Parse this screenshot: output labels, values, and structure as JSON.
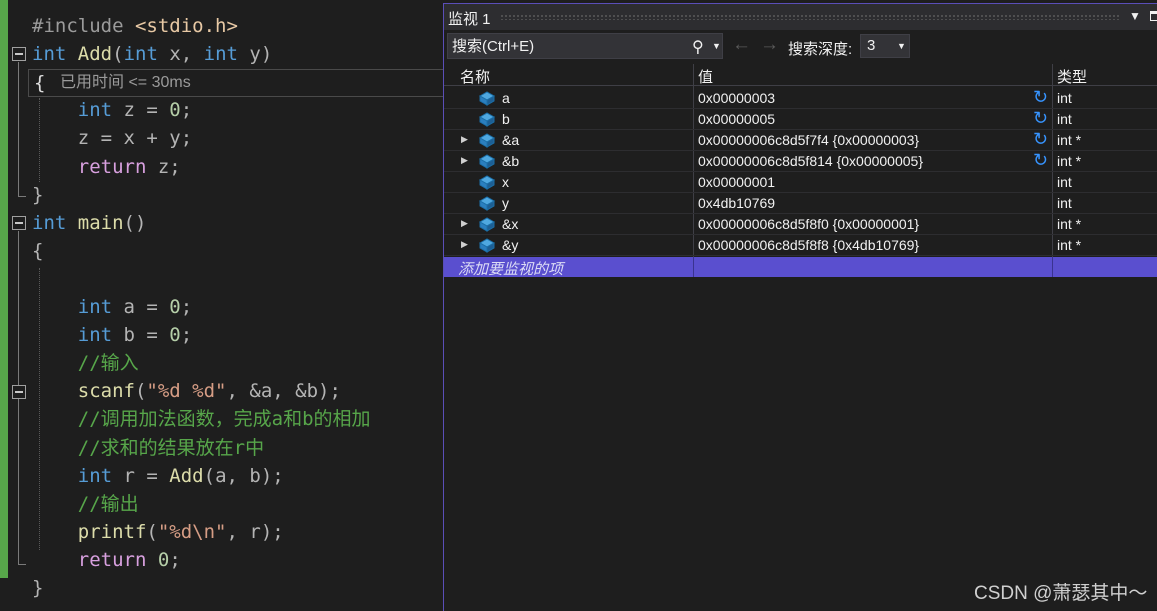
{
  "editor": {
    "perf_tip": "已用时间 <= 30ms",
    "lines": [
      [
        {
          "t": "#include ",
          "c": "pp"
        },
        {
          "t": "<stdio.h>",
          "c": "inc"
        }
      ],
      [
        {
          "t": "int",
          "c": "kw"
        },
        {
          "t": " ",
          "c": "pl"
        },
        {
          "t": "Add",
          "c": "fn"
        },
        {
          "t": "(",
          "c": "pl"
        },
        {
          "t": "int",
          "c": "kw"
        },
        {
          "t": " x, ",
          "c": "pl"
        },
        {
          "t": "int",
          "c": "kw"
        },
        {
          "t": " y)",
          "c": "pl"
        }
      ],
      [],
      [
        {
          "t": "    ",
          "c": "pl"
        },
        {
          "t": "int",
          "c": "kw"
        },
        {
          "t": " z = ",
          "c": "pl"
        },
        {
          "t": "0",
          "c": "num"
        },
        {
          "t": ";",
          "c": "pl"
        }
      ],
      [
        {
          "t": "    z = x + y;",
          "c": "pl"
        }
      ],
      [
        {
          "t": "    ",
          "c": "pl"
        },
        {
          "t": "return",
          "c": "ctl"
        },
        {
          "t": " z;",
          "c": "pl"
        }
      ],
      [
        {
          "t": "}",
          "c": "pl"
        }
      ],
      [
        {
          "t": "int",
          "c": "kw"
        },
        {
          "t": " ",
          "c": "pl"
        },
        {
          "t": "main",
          "c": "fn"
        },
        {
          "t": "()",
          "c": "pl"
        }
      ],
      [
        {
          "t": "{",
          "c": "pl"
        }
      ],
      [],
      [
        {
          "t": "    ",
          "c": "pl"
        },
        {
          "t": "int",
          "c": "kw"
        },
        {
          "t": " a = ",
          "c": "pl"
        },
        {
          "t": "0",
          "c": "num"
        },
        {
          "t": ";",
          "c": "pl"
        }
      ],
      [
        {
          "t": "    ",
          "c": "pl"
        },
        {
          "t": "int",
          "c": "kw"
        },
        {
          "t": " b = ",
          "c": "pl"
        },
        {
          "t": "0",
          "c": "num"
        },
        {
          "t": ";",
          "c": "pl"
        }
      ],
      [
        {
          "t": "    //输入",
          "c": "cmt"
        }
      ],
      [
        {
          "t": "    ",
          "c": "pl"
        },
        {
          "t": "scanf",
          "c": "fn"
        },
        {
          "t": "(",
          "c": "pl"
        },
        {
          "t": "\"%d %d\"",
          "c": "str"
        },
        {
          "t": ", &a, &b);",
          "c": "pl"
        }
      ],
      [
        {
          "t": "    //调用加法函数，完成a和b的相加",
          "c": "cmt"
        }
      ],
      [
        {
          "t": "    //求和的结果放在r中",
          "c": "cmt"
        }
      ],
      [
        {
          "t": "    ",
          "c": "pl"
        },
        {
          "t": "int",
          "c": "kw"
        },
        {
          "t": " r = ",
          "c": "pl"
        },
        {
          "t": "Add",
          "c": "fn"
        },
        {
          "t": "(a, b);",
          "c": "pl"
        }
      ],
      [
        {
          "t": "    //输出",
          "c": "cmt"
        }
      ],
      [
        {
          "t": "    ",
          "c": "pl"
        },
        {
          "t": "printf",
          "c": "fn"
        },
        {
          "t": "(",
          "c": "pl"
        },
        {
          "t": "\"%d\\n\"",
          "c": "str"
        },
        {
          "t": ", r);",
          "c": "pl"
        }
      ],
      [
        {
          "t": "    ",
          "c": "pl"
        },
        {
          "t": "return",
          "c": "ctl"
        },
        {
          "t": " ",
          "c": "pl"
        },
        {
          "t": "0",
          "c": "num"
        },
        {
          "t": ";",
          "c": "pl"
        }
      ],
      [
        {
          "t": "}",
          "c": "pl"
        }
      ]
    ]
  },
  "watch": {
    "title": "监视 1",
    "search_placeholder": "搜索(Ctrl+E)",
    "depth_label": "搜索深度:",
    "depth_value": "3",
    "columns": {
      "name": "名称",
      "value": "值",
      "type": "类型"
    },
    "rows": [
      {
        "name": "a",
        "value": "0x00000003",
        "type": "int",
        "expandable": false,
        "refresh": true
      },
      {
        "name": "b",
        "value": "0x00000005",
        "type": "int",
        "expandable": false,
        "refresh": true
      },
      {
        "name": "&a",
        "value": "0x00000006c8d5f7f4 {0x00000003}",
        "type": "int *",
        "expandable": true,
        "refresh": true
      },
      {
        "name": "&b",
        "value": "0x00000006c8d5f814 {0x00000005}",
        "type": "int *",
        "expandable": true,
        "refresh": true
      },
      {
        "name": "x",
        "value": "0x00000001",
        "type": "int",
        "expandable": false,
        "refresh": false
      },
      {
        "name": "y",
        "value": "0x4db10769",
        "type": "int",
        "expandable": false,
        "refresh": false
      },
      {
        "name": "&x",
        "value": "0x00000006c8d5f8f0 {0x00000001}",
        "type": "int *",
        "expandable": true,
        "refresh": false
      },
      {
        "name": "&y",
        "value": "0x00000006c8d5f8f8 {0x4db10769}",
        "type": "int *",
        "expandable": true,
        "refresh": false
      }
    ],
    "add_item": "添加要监视的项"
  },
  "watermark": "CSDN @萧瑟其中～",
  "icons": {
    "expander": "triangle-right",
    "variable": "blue-cube",
    "refresh": "circular-arrow",
    "search": "magnifier",
    "back": "arrow-left",
    "forward": "arrow-right"
  },
  "colors": {
    "keyword": "#569cd6",
    "function": "#dcdcaa",
    "comment": "#57a64a",
    "string": "#d69d85",
    "add_row_highlight": "#5a4fcf",
    "window_border": "#5a4eb8"
  }
}
